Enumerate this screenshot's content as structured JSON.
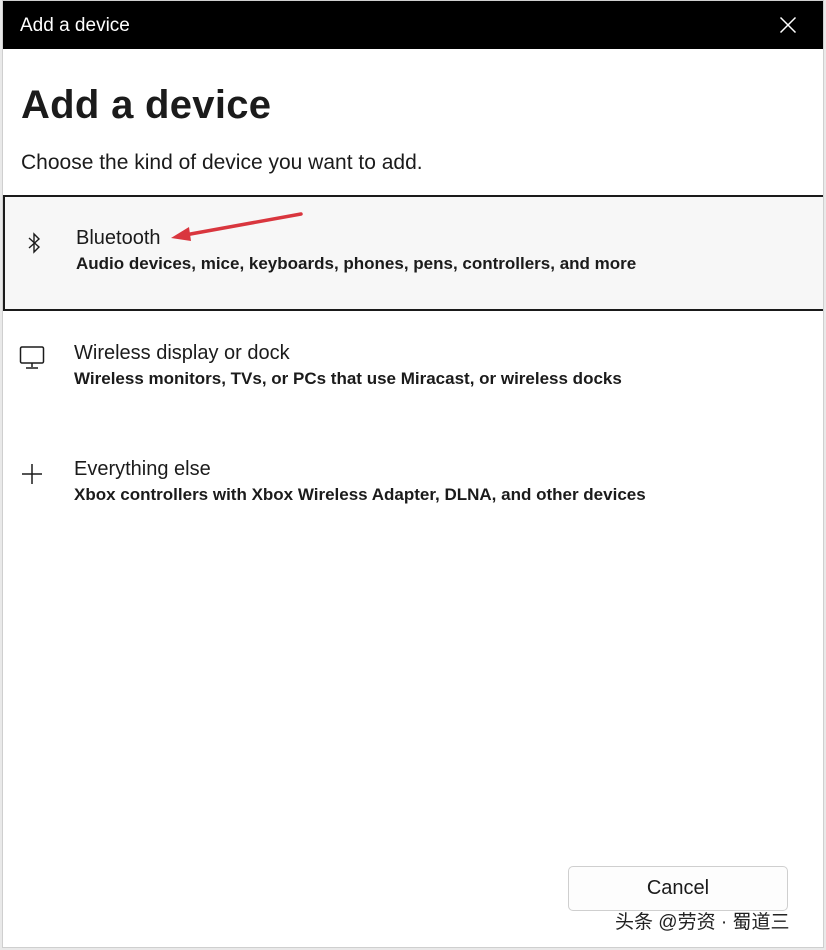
{
  "window": {
    "title": "Add a device"
  },
  "main": {
    "heading": "Add a device",
    "subheading": "Choose the kind of device you want to add."
  },
  "options": [
    {
      "icon": "bluetooth-icon",
      "title": "Bluetooth",
      "description": "Audio devices, mice, keyboards, phones, pens, controllers, and more",
      "selected": true
    },
    {
      "icon": "monitor-icon",
      "title": "Wireless display or dock",
      "description": "Wireless monitors, TVs, or PCs that use Miracast, or wireless docks",
      "selected": false
    },
    {
      "icon": "plus-icon",
      "title": "Everything else",
      "description": "Xbox controllers with Xbox Wireless Adapter, DLNA, and other devices",
      "selected": false
    }
  ],
  "footer": {
    "cancel_label": "Cancel"
  },
  "watermark": {
    "text": "头条 @劳资 · 蜀道三"
  },
  "colors": {
    "titlebar": "#000000",
    "selected_border": "#1a1a1a",
    "annotation_arrow": "#d9363e"
  }
}
